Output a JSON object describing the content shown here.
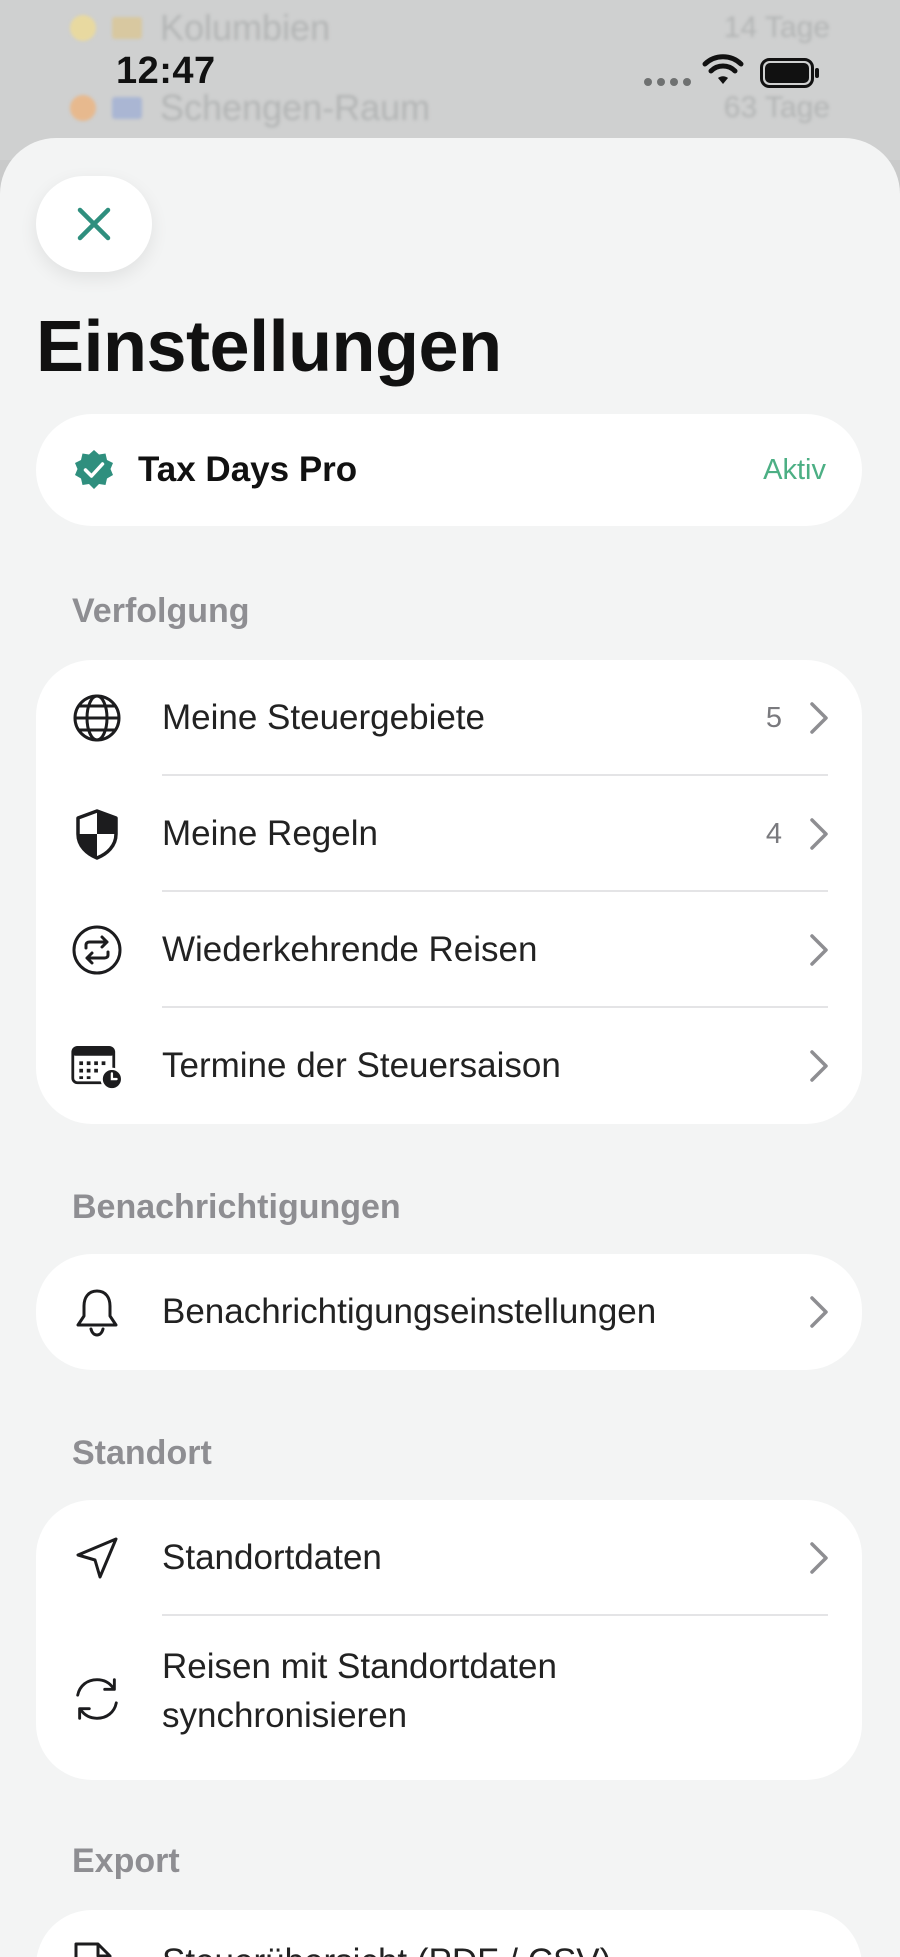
{
  "status_bar": {
    "time": "12:47"
  },
  "background": {
    "rows": [
      {
        "label": "Kolumbien",
        "count": "14 Tage"
      },
      {
        "label": "Schengen-Raum",
        "count": "63 Tage"
      }
    ]
  },
  "header": {
    "title": "Einstellungen"
  },
  "pro": {
    "name": "Tax Days Pro",
    "status": "Aktiv"
  },
  "sections": {
    "tracking": {
      "title": "Verfolgung",
      "items": [
        {
          "label": "Meine Steuergebiete",
          "count": "5",
          "icon": "globe-icon"
        },
        {
          "label": "Meine Regeln",
          "count": "4",
          "icon": "shield-icon"
        },
        {
          "label": "Wiederkehrende Reisen",
          "icon": "repeat-icon"
        },
        {
          "label": "Termine der Steuersaison",
          "icon": "calendar-clock-icon"
        }
      ]
    },
    "notifications": {
      "title": "Benachrichtigungen",
      "items": [
        {
          "label": "Benachrichtigungseinstellungen",
          "icon": "bell-icon"
        }
      ]
    },
    "location": {
      "title": "Standort",
      "items": [
        {
          "label": "Standortdaten",
          "icon": "location-arrow-icon"
        },
        {
          "label": "Reisen mit Standortdaten synchronisieren",
          "icon": "sync-icon"
        }
      ]
    },
    "export": {
      "title": "Export",
      "items": [
        {
          "label": "Steuerübersicht (PDF / CSV)",
          "icon": "document-icon"
        }
      ]
    }
  },
  "colors": {
    "accent": "#2f8f7e",
    "active": "#4caf84",
    "sheet_background": "#f3f4f4",
    "card_background": "#ffffff",
    "section_header": "#8e8e92"
  }
}
